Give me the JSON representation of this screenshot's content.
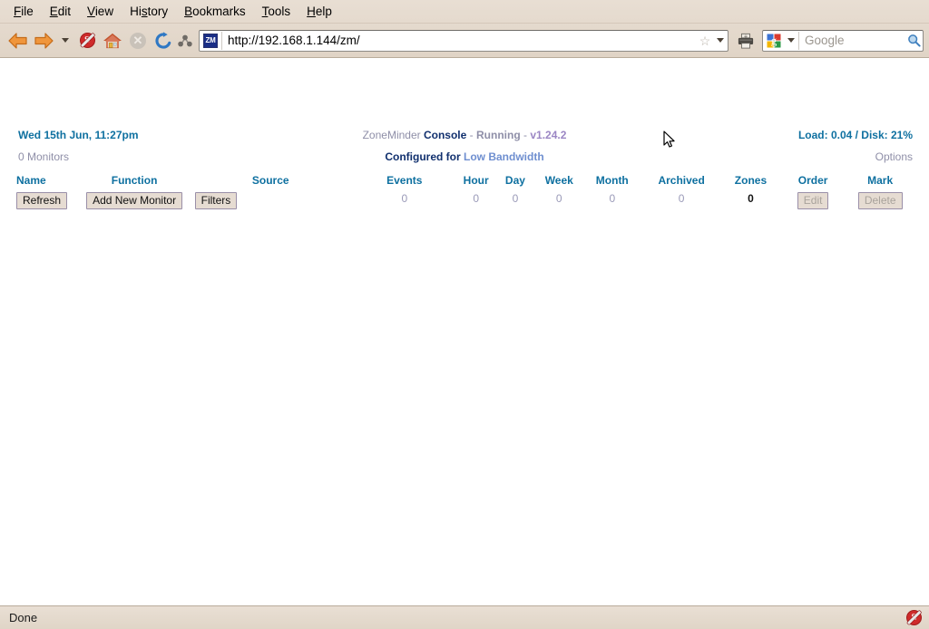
{
  "browser": {
    "menu": [
      {
        "name": "file",
        "label": "File",
        "accel": "F"
      },
      {
        "name": "edit",
        "label": "Edit",
        "accel": "E"
      },
      {
        "name": "view",
        "label": "View",
        "accel": "V"
      },
      {
        "name": "history",
        "label": "History",
        "accel": "s"
      },
      {
        "name": "bookmarks",
        "label": "Bookmarks",
        "accel": "B"
      },
      {
        "name": "tools",
        "label": "Tools",
        "accel": "T"
      },
      {
        "name": "help",
        "label": "Help",
        "accel": "H"
      }
    ],
    "toolbar": {
      "back_icon": "back-arrow-icon",
      "forward_icon": "forward-arrow-icon",
      "history_dropdown_icon": "chevron-down-icon",
      "noscript_icon": "noscript-icon",
      "noscript_label": "S",
      "home_icon": "home-icon",
      "stop_icon": "stop-icon",
      "stop_glyph": "✕",
      "reload_icon": "reload-icon",
      "nodes_icon": "nodes-icon",
      "print_icon": "printer-icon"
    },
    "url": {
      "favicon_label": "ZM",
      "value": "http://192.168.1.144/zm/",
      "star_glyph": "☆"
    },
    "search": {
      "engine": "Google",
      "placeholder": "Google",
      "value": ""
    },
    "status": {
      "text": "Done",
      "noscript_icon": "noscript-icon",
      "noscript_label": "S"
    }
  },
  "zoneminder": {
    "date": "Wed 15th Jun, 11:27pm",
    "monitor_count": "0 Monitors",
    "title": {
      "app": "ZoneMinder",
      "section": "Console",
      "dash1": "-",
      "state": "Running",
      "dash2": "-",
      "version": "v1.24.2"
    },
    "subtitle": {
      "prefix": "Configured for",
      "bandwidth": "Low Bandwidth"
    },
    "load": "Load: 0.04 / Disk: 21%",
    "options": "Options",
    "columns": [
      "Name",
      "Function",
      "Source",
      "Events",
      "Hour",
      "Day",
      "Week",
      "Month",
      "Archived",
      "Zones",
      "Order",
      "Mark"
    ],
    "buttons": {
      "refresh": "Refresh",
      "add_new_monitor": "Add New Monitor",
      "filters": "Filters",
      "edit": "Edit",
      "delete": "Delete"
    },
    "totals": {
      "events": "0",
      "hour": "0",
      "day": "0",
      "week": "0",
      "month": "0",
      "archived": "0",
      "zones": "0"
    }
  }
}
